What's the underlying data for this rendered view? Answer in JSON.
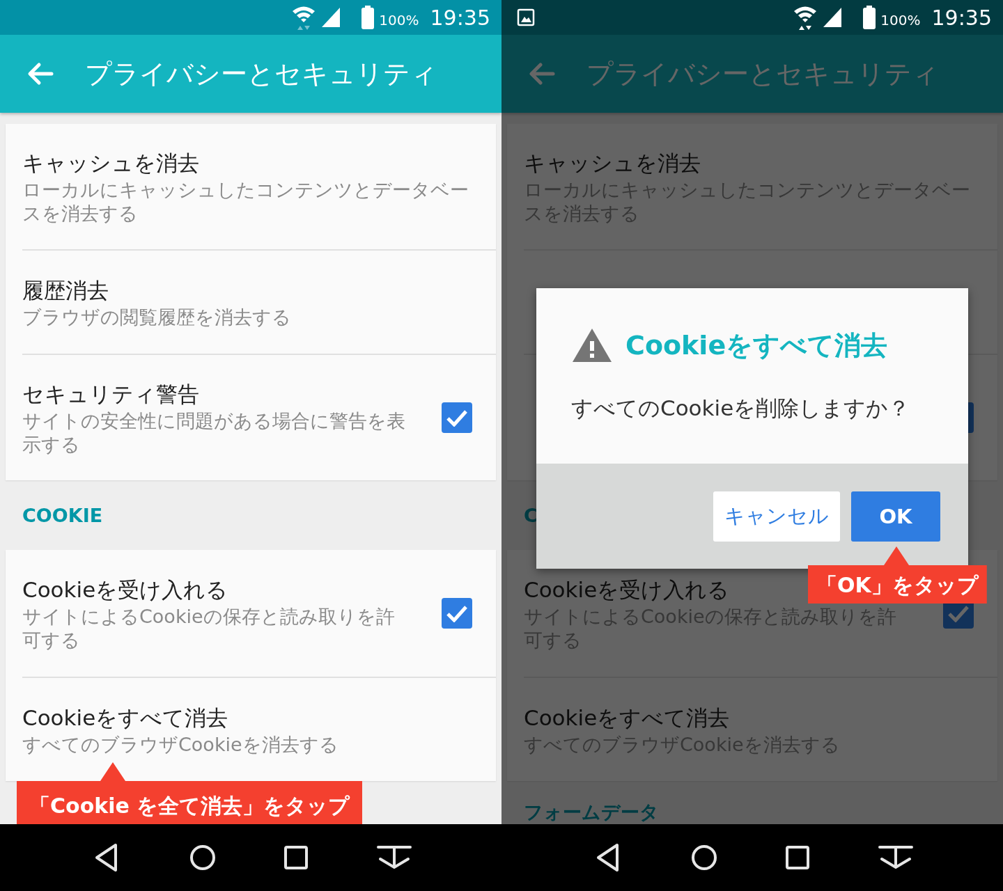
{
  "screens": [
    {
      "dimmed": false,
      "status_bar": {
        "battery": "100%",
        "time": "19:35"
      },
      "app_bar": {
        "title": "プライバシーとセキュリティ"
      },
      "sections": [
        {
          "kind": "card",
          "items": [
            {
              "title": "キャッシュを消去",
              "subtitle": [
                "ローカルにキャッシュしたコンテンツとデータベー",
                "スを消去する"
              ]
            },
            {
              "title": "履歴消去",
              "subtitle": [
                "ブラウザの閲覧履歴を消去する"
              ]
            },
            {
              "title": "セキュリティ警告",
              "subtitle": [
                "サイトの安全性に問題がある場合に警告を表",
                "示する"
              ],
              "checked": true
            }
          ]
        },
        {
          "kind": "header",
          "label": "COOKIE"
        },
        {
          "kind": "card",
          "items": [
            {
              "title": "Cookieを受け入れる",
              "subtitle": [
                "サイトによるCookieの保存と読み取りを許",
                "可する"
              ],
              "checked": true
            },
            {
              "title": "Cookieをすべて消去",
              "subtitle": [
                "すべてのブラウザCookieを消去する"
              ]
            }
          ]
        }
      ],
      "callout": {
        "text": "「Cookie を全て消去」をタップ"
      }
    },
    {
      "dimmed": true,
      "notifications": [
        {
          "kind": "image"
        }
      ],
      "status_bar": {
        "battery": "100%",
        "time": "19:35"
      },
      "app_bar": {
        "title": "プライバシーとセキュリティ"
      },
      "sections": [
        {
          "kind": "card",
          "items": [
            {
              "title": "キャッシュを消去",
              "subtitle": [
                "ローカルにキャッシュしたコンテンツとデータベー",
                "スを消去する"
              ]
            },
            {
              "kind": "covered"
            },
            {
              "kind": "covered",
              "checked": true
            }
          ]
        },
        {
          "kind": "header",
          "label": "C"
        },
        {
          "kind": "card",
          "items": [
            {
              "title": "Cookieを受け入れる",
              "subtitle": [
                "サイトによるCookieの保存と読み取りを許",
                "可する"
              ],
              "checked": true
            },
            {
              "title": "Cookieをすべて消去",
              "subtitle": [
                "すべてのブラウザCookieを消去する"
              ]
            }
          ]
        },
        {
          "kind": "header",
          "label": "フォームデータ"
        }
      ],
      "dialog": {
        "title": "Cookieをすべて消去",
        "message": "すべてのCookieを削除しますか？",
        "buttons": [
          {
            "label": "キャンセル",
            "kind": "secondary"
          },
          {
            "label": "OK",
            "kind": "primary"
          }
        ]
      },
      "callout": {
        "text": "「OK」をタップ"
      }
    }
  ]
}
